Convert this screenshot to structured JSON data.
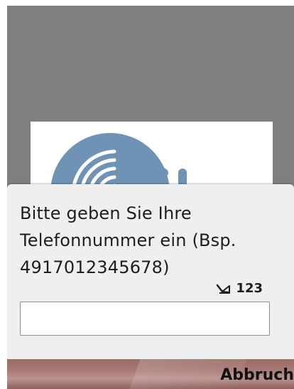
{
  "dialog": {
    "prompt": "Bitte geben Sie Ihre Telefonnummer ein (Bsp. 4917012345678)",
    "input_mode": "123",
    "input_value": ""
  },
  "softkeys": {
    "right_label": "Abbruch"
  },
  "colors": {
    "screen_background": "#7f7f7f",
    "dialog_background": "#efefef",
    "logo_blue": "#6e93b4",
    "softkey_bar": "#a67873"
  },
  "icons": {
    "splash_logo": "app-logo-icon",
    "input_mode": "pen-icon"
  }
}
